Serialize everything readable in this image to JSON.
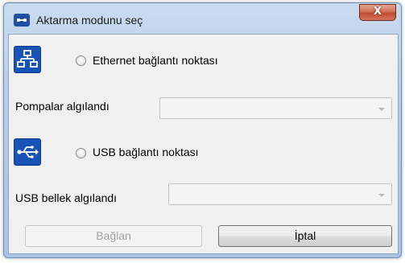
{
  "window": {
    "title": "Aktarma modunu seç",
    "close_glyph": "X"
  },
  "ethernet": {
    "icon": "network-icon",
    "label": "Ethernet bağlantı noktası",
    "selected": false
  },
  "pumps": {
    "label": "Pompalar algılandı",
    "value": ""
  },
  "usb": {
    "icon": "usb-icon",
    "label": "USB bağlantı noktası",
    "selected": false
  },
  "usb_memory": {
    "label": "USB bellek algılandı",
    "value": ""
  },
  "buttons": {
    "connect": "Bağlan",
    "cancel": "İptal"
  },
  "colors": {
    "icon_blue": "#1a53b8",
    "close_red": "#c04a30",
    "frame": "#aac3e0"
  }
}
